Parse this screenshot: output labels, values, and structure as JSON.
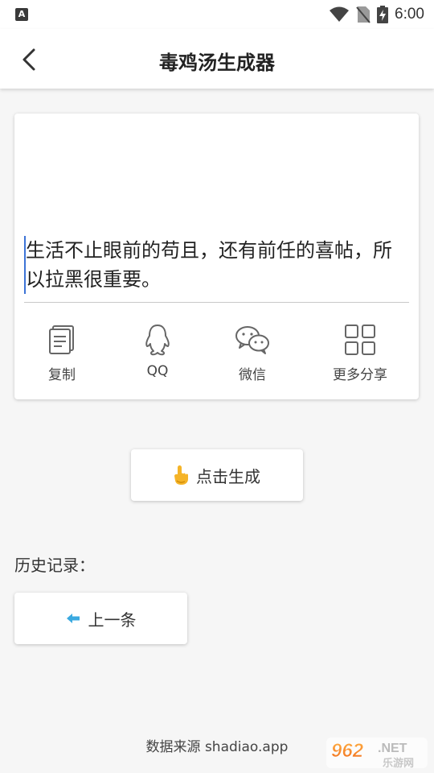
{
  "status_bar": {
    "app_icon_letter": "A",
    "time": "6:00",
    "icons": [
      "wifi-icon",
      "no-sim-icon",
      "battery-charging-icon"
    ]
  },
  "header": {
    "back_icon": "back-arrow-icon",
    "title": "毒鸡汤生成器"
  },
  "quote": {
    "text": "生活不止眼前的苟且，还有前任的喜帖，所以拉黑很重要。"
  },
  "share_actions": [
    {
      "label": "复制",
      "icon": "copy-icon"
    },
    {
      "label": "QQ",
      "icon": "qq-icon"
    },
    {
      "label": "微信",
      "icon": "wechat-icon"
    },
    {
      "label": "更多分享",
      "icon": "more-share-icon"
    }
  ],
  "generate": {
    "label": "点击生成",
    "icon": "pointing-hand-icon"
  },
  "history": {
    "label": "历史记录：",
    "prev_label": "上一条",
    "prev_icon": "arrow-left-icon"
  },
  "footer": {
    "source_text": "数据来源 shadiao.app"
  },
  "watermark": {
    "number": "962",
    "suffix": ".NET",
    "site": "乐游网"
  },
  "colors": {
    "background": "#f6f6f6",
    "card": "#ffffff",
    "cursor": "#3d73d6",
    "arrow_accent": "#3aa9e0",
    "hand_accent": "#f5b428"
  }
}
